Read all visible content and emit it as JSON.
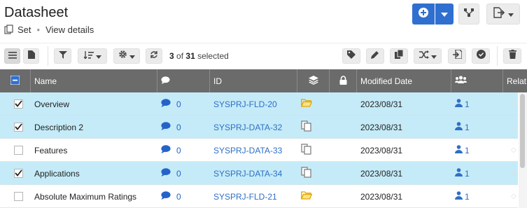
{
  "header": {
    "title": "Datasheet",
    "set_label": "Set",
    "separator": "•",
    "view_details": "View details"
  },
  "toolbar": {
    "selected_count": "3",
    "of_label": "of",
    "total_count": "31",
    "selected_label": "selected"
  },
  "table": {
    "columns": {
      "name": "Name",
      "id": "ID",
      "modified": "Modified Date",
      "relations": "Relat"
    },
    "rows": [
      {
        "checked": true,
        "name": "Overview",
        "comments": "0",
        "id": "SYSPRJ-FLD-20",
        "type": "folder",
        "date": "2023/08/31",
        "users": "1"
      },
      {
        "checked": true,
        "name": "Description 2",
        "comments": "0",
        "id": "SYSPRJ-DATA-32",
        "type": "copy",
        "date": "2023/08/31",
        "users": "1"
      },
      {
        "checked": false,
        "name": "Features",
        "comments": "0",
        "id": "SYSPRJ-DATA-33",
        "type": "copy",
        "date": "2023/08/31",
        "users": "1"
      },
      {
        "checked": true,
        "name": "Applications",
        "comments": "0",
        "id": "SYSPRJ-DATA-34",
        "type": "copy",
        "date": "2023/08/31",
        "users": "1"
      },
      {
        "checked": false,
        "name": "Absolute Maximum Ratings",
        "comments": "0",
        "id": "SYSPRJ-FLD-21",
        "type": "folder",
        "date": "2023/08/31",
        "users": "1"
      }
    ]
  },
  "colors": {
    "primary": "#2f6fd0",
    "link": "#2f6fc6",
    "header_bg": "#6b6b6b",
    "selected_row": "#c5ebf8",
    "folder": "#f2b705"
  }
}
